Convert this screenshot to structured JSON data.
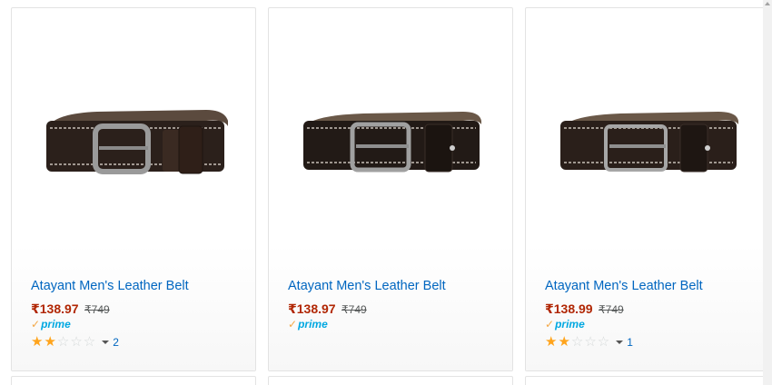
{
  "products": [
    {
      "title": "Atayant Men's Leather Belt",
      "price": "₹138.97",
      "mrp": "₹749",
      "prime": "prime",
      "rating": 2,
      "max_rating": 5,
      "review_count": "2",
      "image": "brown-leather-belt-image"
    },
    {
      "title": "Atayant Men's Leather Belt",
      "price": "₹138.97",
      "mrp": "₹749",
      "prime": "prime",
      "rating": 0,
      "max_rating": 5,
      "review_count": "",
      "image": "dark-brown-leather-belt-image"
    },
    {
      "title": "Atayant Men's Leather Belt",
      "price": "₹138.99",
      "mrp": "₹749",
      "prime": "prime",
      "rating": 2,
      "max_rating": 5,
      "review_count": "1",
      "image": "brown-leather-belt-image"
    }
  ],
  "colors": {
    "link": "#0066c0",
    "price": "#b12704",
    "prime": "#00a8e1",
    "star": "#ffa41c"
  },
  "icons": {
    "prime_check": "check-icon",
    "rating_caret": "chevron-down-icon"
  }
}
